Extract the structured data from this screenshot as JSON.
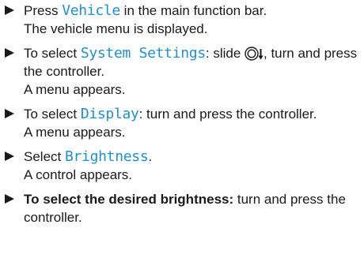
{
  "steps": [
    {
      "pre": "Press ",
      "ui": "Vehicle",
      "post": " in the main function bar.",
      "result": "The vehicle menu is displayed."
    },
    {
      "pre": "To select ",
      "ui": "System Settings",
      "post1": ": slide ",
      "icon": "controller-slide-down-icon",
      "post2": ", turn and press the controller.",
      "result": "A menu appears."
    },
    {
      "pre": "To select ",
      "ui": "Display",
      "post": ": turn and press the controller.",
      "result": "A menu appears."
    },
    {
      "pre": "Select ",
      "ui": "Brightness",
      "post": ".",
      "result": "A control appears."
    },
    {
      "bold": "To select the desired brightness:",
      "post": " turn and press the controller."
    }
  ],
  "colors": {
    "ui_text": "#1f8fd6",
    "body_text": "#1a1a1a"
  }
}
